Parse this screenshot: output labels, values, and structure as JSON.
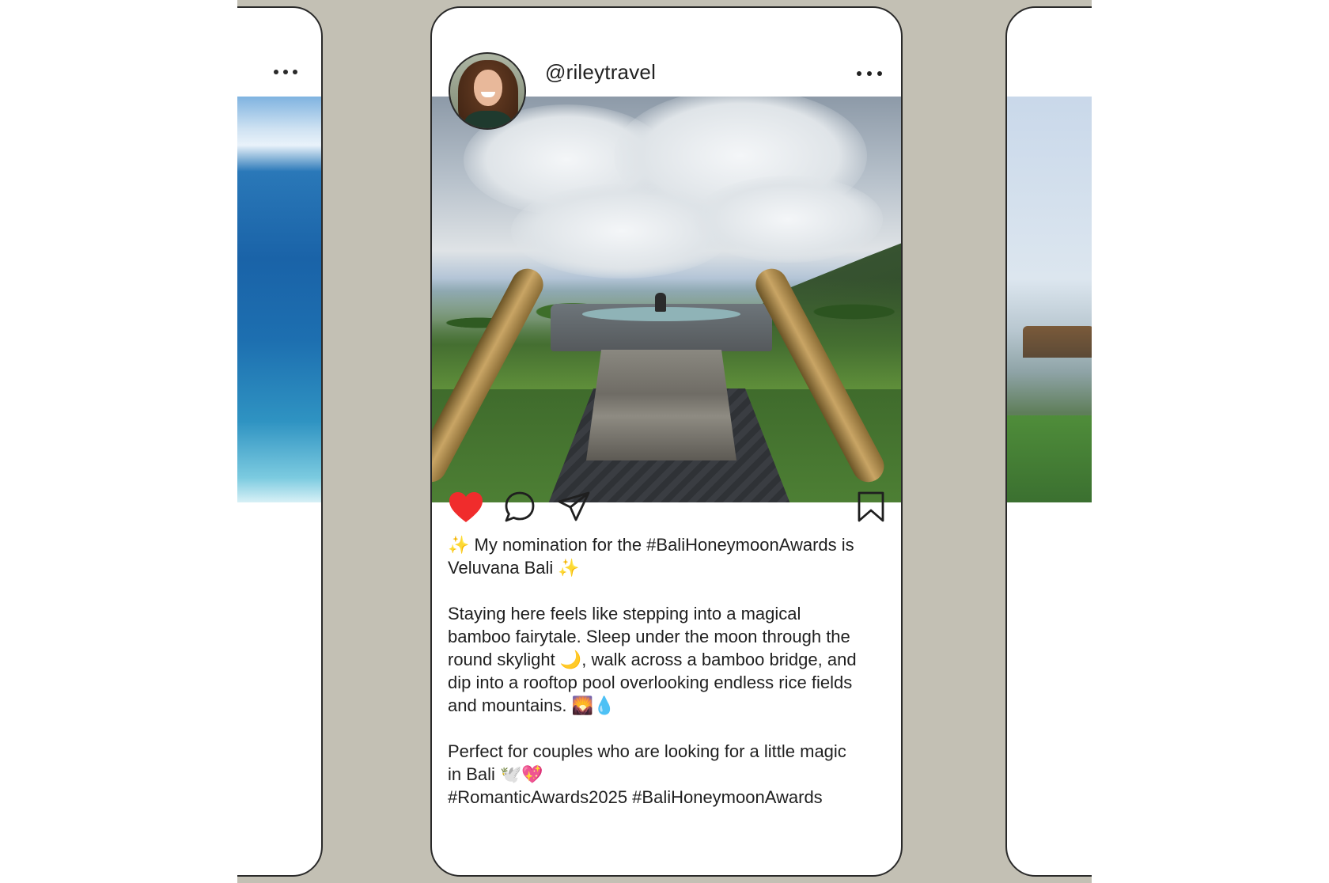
{
  "post": {
    "username": "@rileytravel",
    "caption_line1": "✨ My nomination for the #BaliHoneymoonAwards is Veluvana Bali ✨",
    "caption_para1": "Staying here feels like stepping into a magical bamboo fairytale. Sleep under the moon through the round skylight 🌙, walk across a bamboo bridge, and dip into a rooftop pool overlooking endless rice fields and mountains. 🌄💧",
    "caption_para2": "Perfect for couples who are looking for a little magic in Bali 🕊️💖",
    "hashtags": "#RomanticAwards2025 #BaliHoneymoonAwards",
    "liked": true
  },
  "icons": {
    "more": "more-horizontal-icon",
    "like": "heart-icon",
    "comment": "comment-icon",
    "share": "send-icon",
    "save": "bookmark-icon"
  },
  "colors": {
    "background": "#c3c0b4",
    "card_border": "#2a2a2a",
    "like_red": "#f02c2c",
    "text": "#1f1f1f"
  }
}
